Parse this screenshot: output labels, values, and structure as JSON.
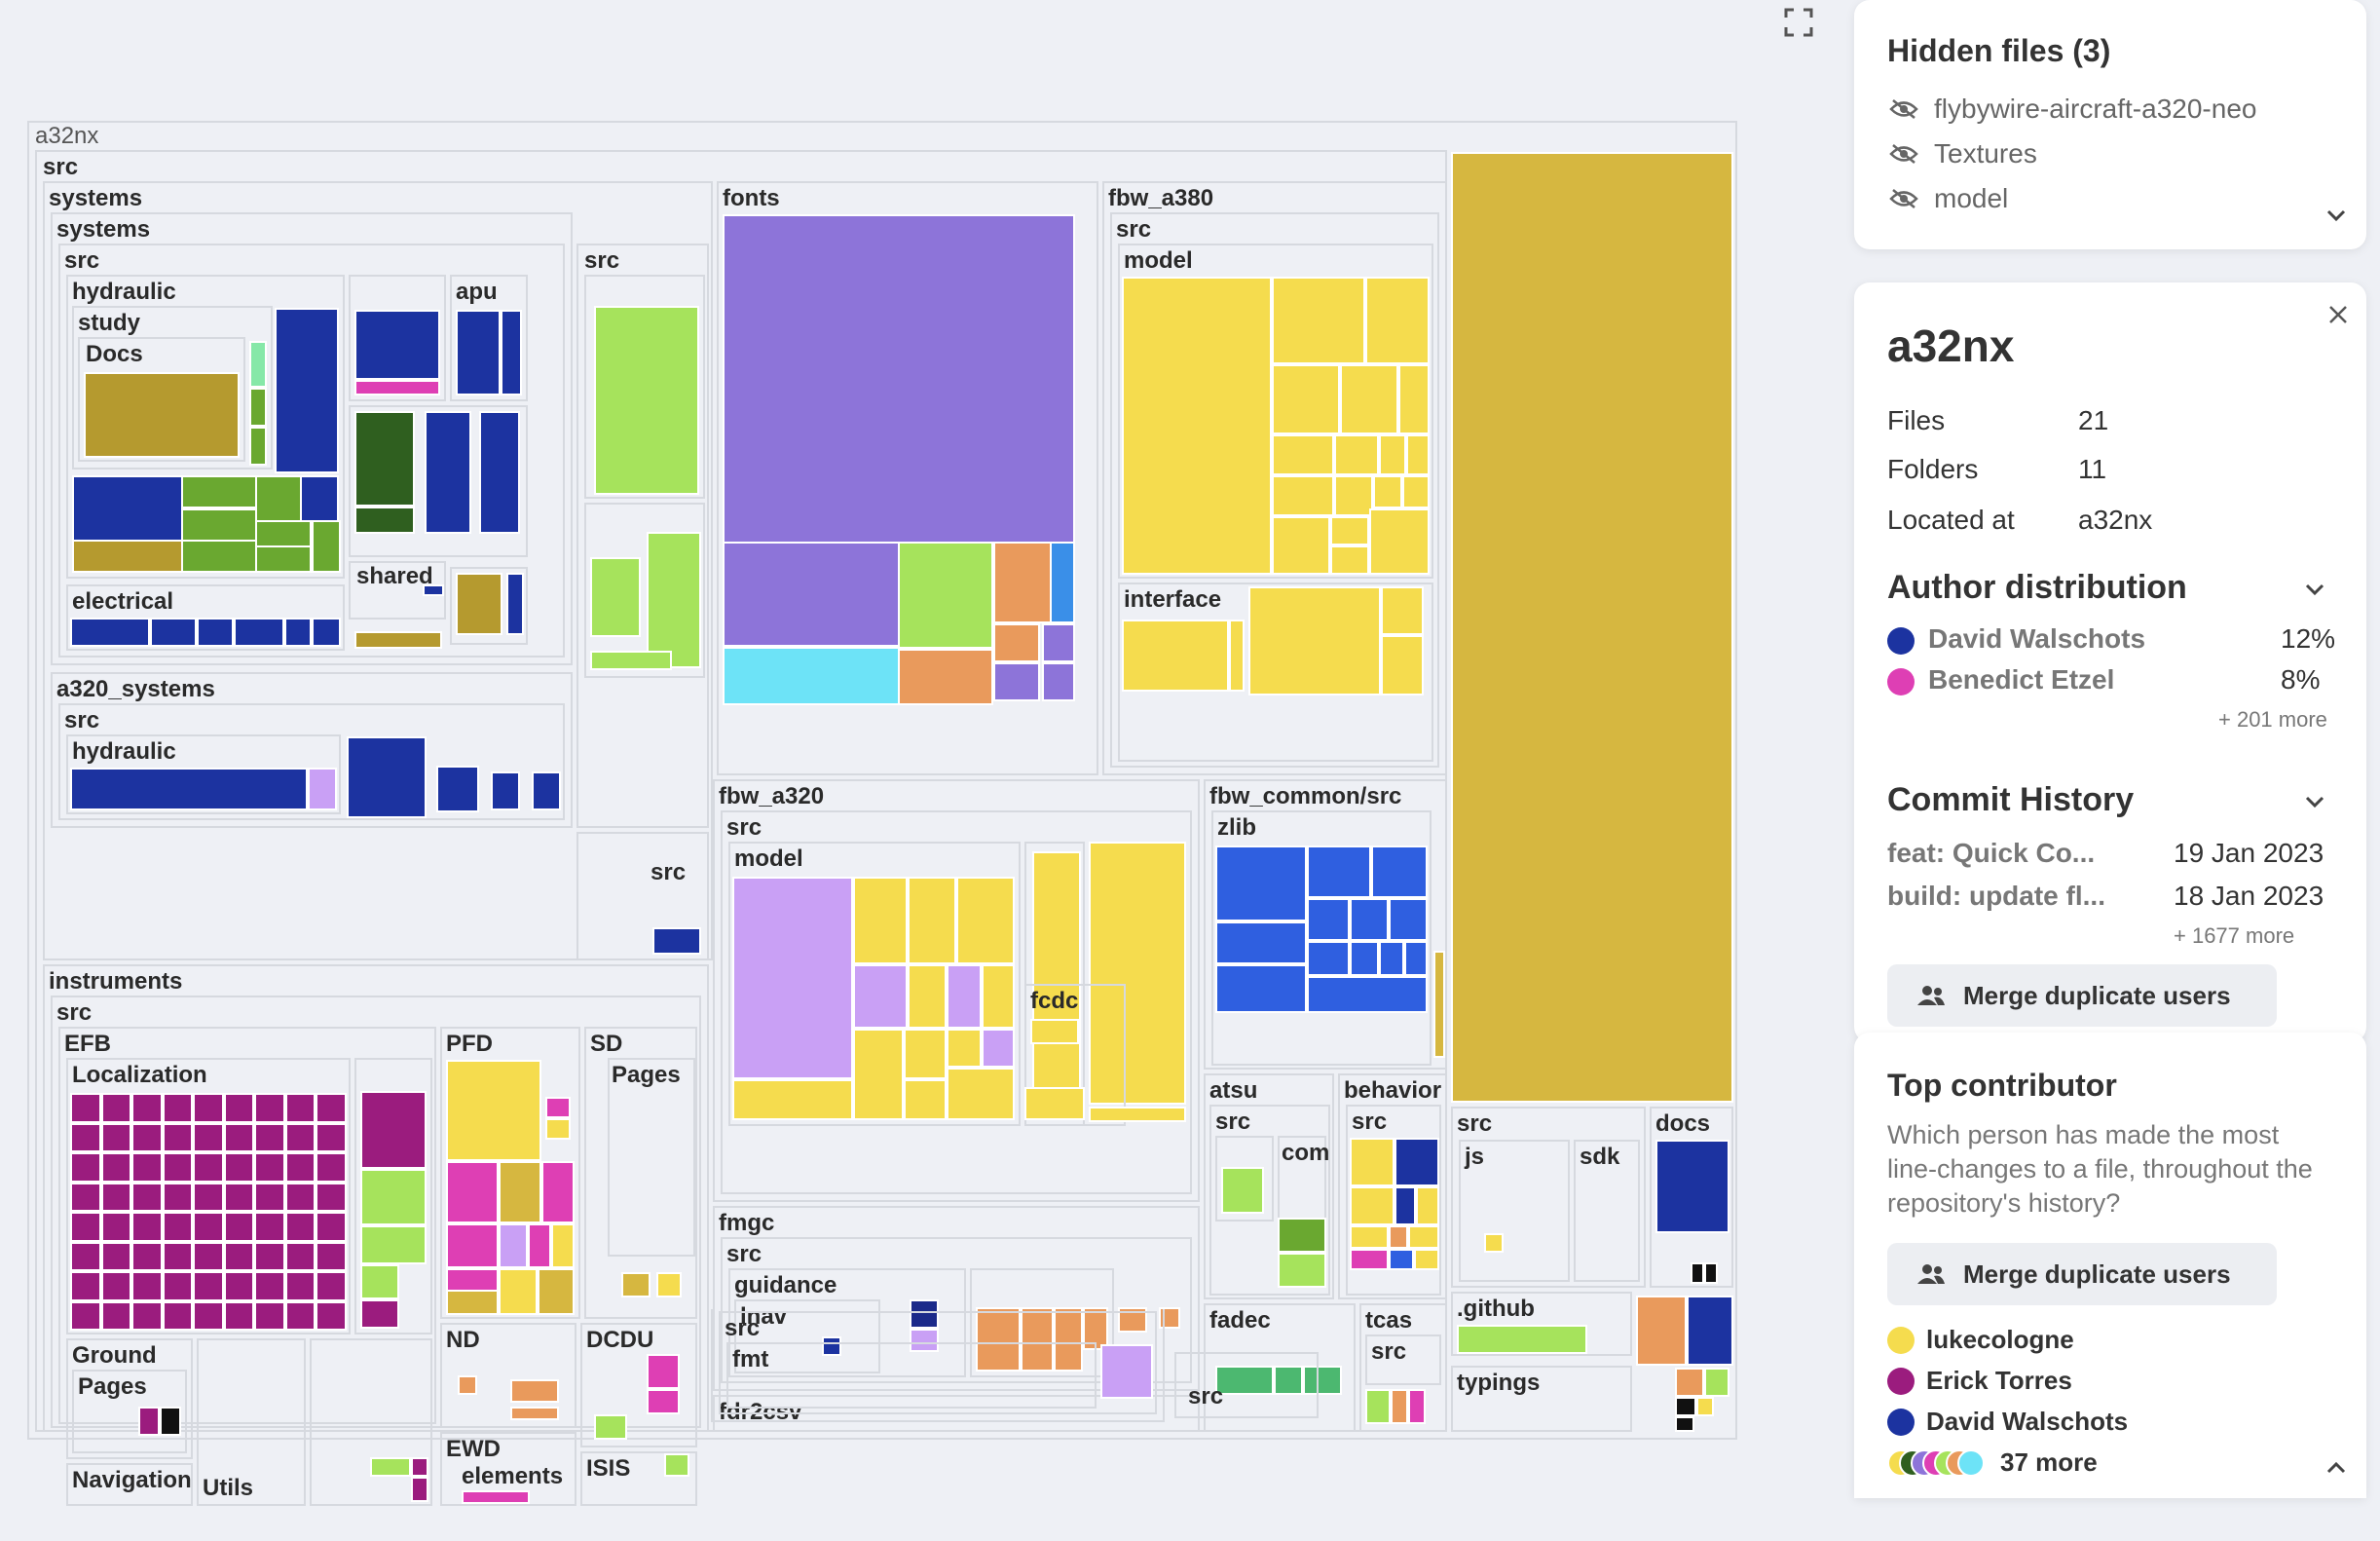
{
  "treemap": {
    "root": "a32nx",
    "labels": {
      "src": "src",
      "systems": "systems",
      "systems2": "systems",
      "src2": "src",
      "hydraulic": "hydraulic",
      "study": "study",
      "docs": "Docs",
      "apu": "apu",
      "shared": "shared",
      "electrical": "electrical",
      "src_right": "src",
      "a320_systems": "a320_systems",
      "a320_src": "src",
      "a320_hydraulic": "hydraulic",
      "src_small": "src",
      "fonts": "fonts",
      "fbw_a380": "fbw_a380",
      "a380_src": "src",
      "model": "model",
      "interface": "interface",
      "fbw_a320": "fbw_a320",
      "a320_src2": "src",
      "a320_model": "model",
      "fcdc": "fcdc",
      "fbw_common": "fbw_common/src",
      "zlib": "zlib",
      "atsu": "atsu",
      "atsu_src": "src",
      "com": "com",
      "behavior": "behavior",
      "behavior_src": "src",
      "fmgc": "fmgc",
      "fmgc_src": "src",
      "guidance": "guidance",
      "lnav": "lnav",
      "fdr2csv": "fdr2csv",
      "fdr_src": "src",
      "fmt": "fmt",
      "fadec": "fadec",
      "tcas": "tcas",
      "tcas_src": "src",
      "src_bottom": "src",
      "instruments": "instruments",
      "inst_src": "src",
      "efb": "EFB",
      "localization": "Localization",
      "ground": "Ground",
      "pages": "Pages",
      "navigation": "Navigation",
      "utils": "Utils",
      "pfd": "PFD",
      "sd": "SD",
      "sd_pages": "Pages",
      "nd": "ND",
      "dcdu": "DCDU",
      "ewd": "EWD",
      "elements": "elements",
      "isis": "ISIS",
      "src_big": "src",
      "js": "js",
      "sdk": "sdk",
      "docs2": "docs",
      "github": ".github",
      "typings": "typings"
    }
  },
  "hidden": {
    "title": "Hidden files (3)",
    "items": [
      "flybywire-aircraft-a320-neo",
      "Textures",
      "model"
    ]
  },
  "details": {
    "name": "a32nx",
    "rows": [
      {
        "label": "Files",
        "value": "21"
      },
      {
        "label": "Folders",
        "value": "11"
      },
      {
        "label": "Located at",
        "value": "a32nx"
      }
    ],
    "author_title": "Author distribution",
    "authors": [
      {
        "name": "David Walschots",
        "pct": "12%",
        "color": "#1c33a0"
      },
      {
        "name": "Benedict Etzel",
        "pct": "8%",
        "color": "#de3fb4"
      }
    ],
    "authors_more": "+ 201 more",
    "commit_title": "Commit History",
    "commits": [
      {
        "msg": "feat: Quick Co...",
        "date": "19 Jan 2023"
      },
      {
        "msg": "build: update fl...",
        "date": "18 Jan 2023"
      }
    ],
    "commits_more": "+ 1677 more",
    "merge_label": "Merge duplicate users"
  },
  "contributor": {
    "title": "Top contributor",
    "desc": "Which person has made the most line-changes to a file, throughout the repository's history?",
    "merge_label": "Merge duplicate users",
    "people": [
      {
        "name": "lukecologne",
        "color": "#f5dc4e"
      },
      {
        "name": "Erick Torres",
        "color": "#9b1c7e"
      },
      {
        "name": "David Walschots",
        "color": "#1c33a0"
      }
    ],
    "more": "37 more"
  },
  "colors": {
    "purple": "#8d74d9",
    "yellow": "#f5dc4e",
    "gold": "#d6b740",
    "green": "#a6e35c",
    "blue": "#1c33a0",
    "royal": "#2f5fe0",
    "magenta": "#9b1c7e",
    "pink": "#de3fb4",
    "orange": "#e99a5c",
    "cyan": "#6de3f7",
    "olive": "#b59a2f",
    "darkgreen": "#2f5f1f"
  }
}
